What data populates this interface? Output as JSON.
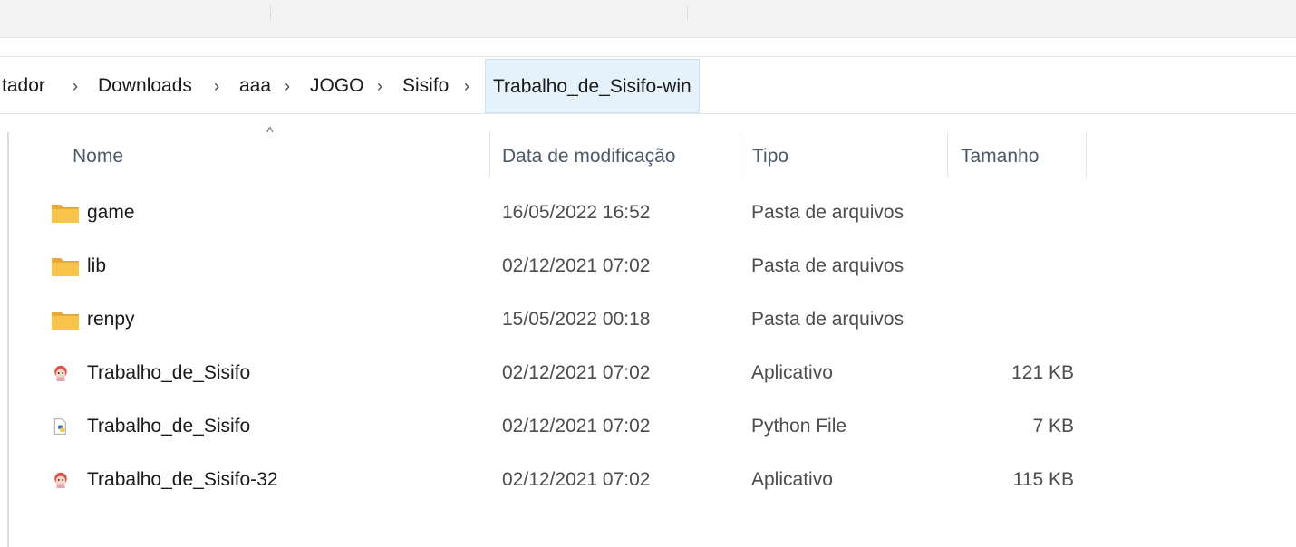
{
  "breadcrumb": {
    "items": [
      "tador",
      "Downloads",
      "aaa",
      "JOGO",
      "Sisifo",
      "Trabalho_de_Sisifo-win"
    ],
    "separator": "›"
  },
  "columns": {
    "name": "Nome",
    "date": "Data de modificação",
    "type": "Tipo",
    "size": "Tamanho",
    "sort_indicator": "^"
  },
  "files": [
    {
      "icon": "folder-icon",
      "name": "game",
      "date": "16/05/2022 16:52",
      "type": "Pasta de arquivos",
      "size": ""
    },
    {
      "icon": "folder-icon",
      "name": "lib",
      "date": "02/12/2021 07:02",
      "type": "Pasta de arquivos",
      "size": ""
    },
    {
      "icon": "folder-icon",
      "name": "renpy",
      "date": "15/05/2022 00:18",
      "type": "Pasta de arquivos",
      "size": ""
    },
    {
      "icon": "app-icon",
      "name": "Trabalho_de_Sisifo",
      "date": "02/12/2021 07:02",
      "type": "Aplicativo",
      "size": "121 KB"
    },
    {
      "icon": "python-file-icon",
      "name": "Trabalho_de_Sisifo",
      "date": "02/12/2021 07:02",
      "type": "Python File",
      "size": "7 KB"
    },
    {
      "icon": "app-icon",
      "name": "Trabalho_de_Sisifo-32",
      "date": "02/12/2021 07:02",
      "type": "Aplicativo",
      "size": "115 KB"
    }
  ],
  "colors": {
    "folder": "#f8c44a",
    "selection": "#e5f1fb",
    "header_text": "#4a5a6b"
  }
}
